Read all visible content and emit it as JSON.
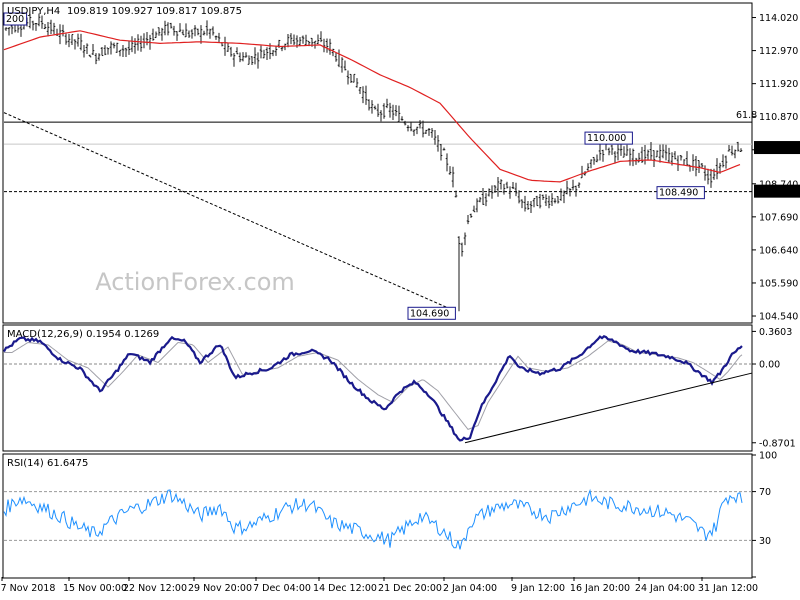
{
  "chart_data": [
    {
      "type": "candlestick",
      "title": "USDJPY,H4",
      "ohlc_header": "109.819 109.927 109.817 109.875",
      "y_ticks": [
        "114.020",
        "112.970",
        "111.920",
        "110.870",
        "109.820",
        "108.740",
        "107.690",
        "106.640",
        "105.590",
        "104.540"
      ],
      "y_tick_values": [
        114.02,
        112.97,
        111.92,
        110.87,
        109.82,
        108.74,
        107.69,
        106.64,
        105.59,
        104.54
      ],
      "ylim": [
        104.35,
        114.45
      ],
      "last_price": "109.875",
      "last_price_value": 109.875,
      "level_line": "108.490",
      "level_line_value": 108.49,
      "fib_label": "61.8",
      "fib_value": 110.7,
      "annotations": [
        {
          "text": "200",
          "value": 114.2
        },
        {
          "text": "110.000",
          "value": 110.0
        },
        {
          "text": "108.490",
          "value": 108.49
        },
        {
          "text": "104.690",
          "value": 104.69
        }
      ],
      "moving_average_color": "#e02020",
      "watermark": "ActionForex.com",
      "x_start": "7 Nov 2018",
      "x_end": "31 Jan 12:00"
    },
    {
      "type": "line",
      "title": "MACD(12,26,9) 0.1954 0.1269",
      "y_ticks": [
        "0.3603",
        "0.00",
        "-0.8701"
      ],
      "y_tick_values": [
        0.3603,
        0.0,
        -0.8701
      ],
      "ylim": [
        -0.95,
        0.42
      ],
      "series": [
        {
          "name": "MACD",
          "color": "#1a1a8c",
          "value": 0.1954
        },
        {
          "name": "Signal",
          "color": "#a0a0a8",
          "value": 0.1269
        }
      ]
    },
    {
      "type": "line",
      "title": "RSI(14) 61.6475",
      "y_ticks": [
        "100",
        "70",
        "30",
        "0"
      ],
      "y_tick_values": [
        100,
        70,
        30,
        0
      ],
      "ylim": [
        0,
        100
      ],
      "levels": [
        70,
        30
      ],
      "series": [
        {
          "name": "RSI(14)",
          "color": "#1e90ff",
          "value": 61.6475
        }
      ]
    }
  ],
  "x_axis": {
    "labels": [
      "7 Nov 2018",
      "15 Nov 00:00",
      "22 Nov 12:00",
      "29 Nov 20:00",
      "7 Dec 04:00",
      "14 Dec 12:00",
      "21 Dec 20:00",
      "2 Jan 04:00",
      "9 Jan 12:00",
      "16 Jan 20:00",
      "24 Jan 04:00",
      "31 Jan 12:00"
    ]
  },
  "colors": {
    "axis": "#000000",
    "grid": "#c8c8c8",
    "candle": "#1a1a1a",
    "ma": "#e02020",
    "macd": "#1a1a8c",
    "signal": "#a0a0a8",
    "rsi": "#1e90ff",
    "watermark": "#c0c0c0"
  }
}
